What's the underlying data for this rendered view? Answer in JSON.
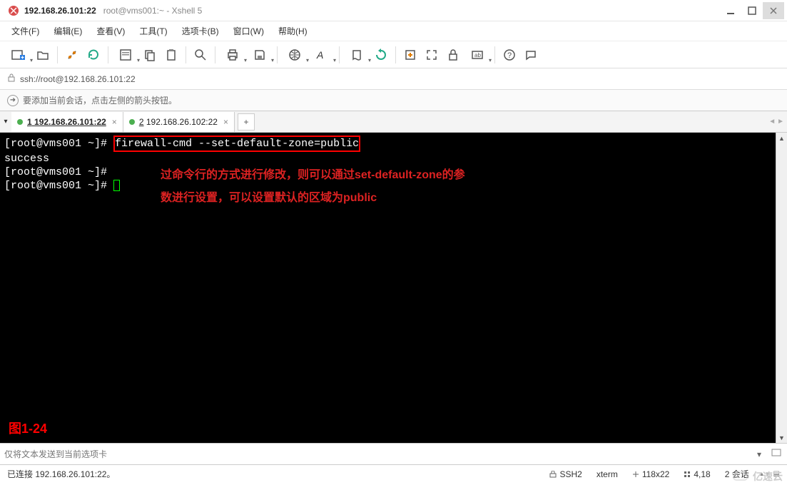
{
  "window": {
    "address": "192.168.26.101:22",
    "subtitle": "root@vms001:~ - Xshell 5"
  },
  "menu": {
    "file": "文件(F)",
    "edit": "编辑(E)",
    "view": "查看(V)",
    "tools": "工具(T)",
    "tabs": "选项卡(B)",
    "window": "窗口(W)",
    "help": "帮助(H)"
  },
  "addressbar": {
    "url": "ssh://root@192.168.26.101:22"
  },
  "tipbar": {
    "icon": "➜",
    "text": "要添加当前会话，点击左侧的箭头按钮。"
  },
  "tabs": [
    {
      "index": "1",
      "label": "192.168.26.101:22",
      "active": true
    },
    {
      "index": "2",
      "label": "192.168.26.102:22",
      "active": false
    }
  ],
  "terminal": {
    "prompt1": "[root@vms001 ~]# ",
    "command": "firewall-cmd --set-default-zone=public",
    "line2": "success",
    "prompt3": "[root@vms001 ~]#",
    "prompt4": "[root@vms001 ~]# "
  },
  "annotation": {
    "line1": "过命令行的方式进行修改，则可以通过set-default-zone的参",
    "line2": "数进行设置，可以设置默认的区域为public",
    "figure": "图1-24"
  },
  "inputbar": {
    "placeholder": "仅将文本发送到当前选项卡"
  },
  "status": {
    "conn": "已连接 192.168.26.101:22。",
    "proto": "SSH2",
    "term": "xterm",
    "size": "118x22",
    "pos": "4,18",
    "sessions": "2 会话"
  },
  "watermark": "亿速云"
}
